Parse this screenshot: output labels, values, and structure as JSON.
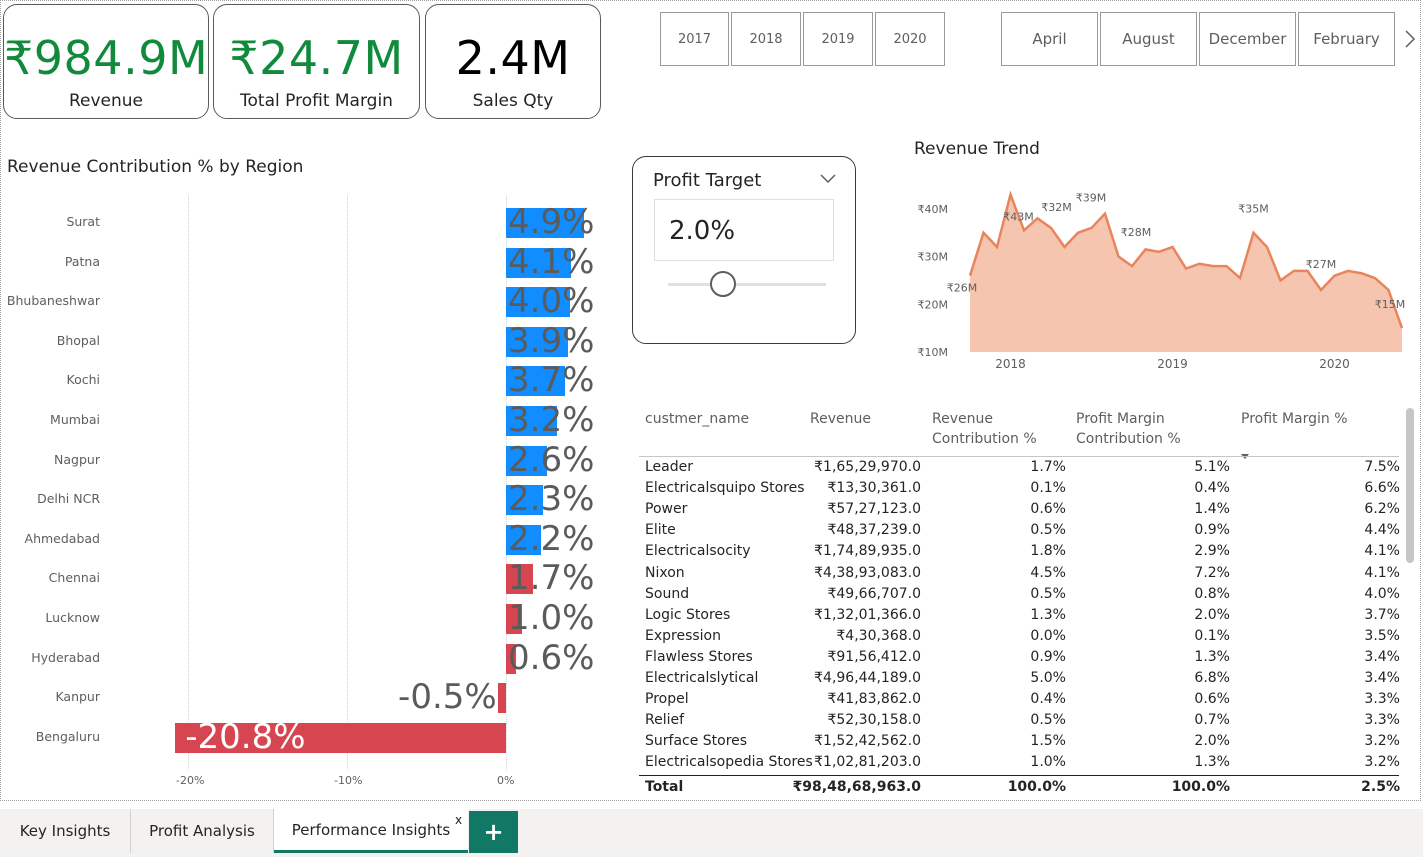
{
  "kpis": [
    {
      "value": "₹984.9M",
      "label": "Revenue",
      "color": "#118a3c"
    },
    {
      "value": "₹24.7M",
      "label": "Total Profit Margin",
      "color": "#118a3c"
    },
    {
      "value": "2.4M",
      "label": "Sales Qty",
      "color": "#000000"
    }
  ],
  "year_slicer": [
    "2017",
    "2018",
    "2019",
    "2020"
  ],
  "month_slicer": [
    "April",
    "August",
    "December",
    "February"
  ],
  "month_next_icon": "chevron-right-icon",
  "region_chart": {
    "title": "Revenue Contribution % by Region",
    "xticks": [
      "-20%",
      "-10%",
      "0%"
    ]
  },
  "profit_target": {
    "title": "Profit Target",
    "value": "2.0%",
    "slider_level": 0.0
  },
  "revenue_trend": {
    "title": "Revenue Trend"
  },
  "table": {
    "headers": [
      "custmer_name",
      "Revenue",
      "Revenue Contribution %",
      "Profit Margin Contribution %",
      "Profit Margin %"
    ],
    "rows": [
      [
        "Leader",
        "₹1,65,29,970.0",
        "1.7%",
        "5.1%",
        "7.5%"
      ],
      [
        "Electricalsquipo Stores",
        "₹13,30,361.0",
        "0.1%",
        "0.4%",
        "6.6%"
      ],
      [
        "Power",
        "₹57,27,123.0",
        "0.6%",
        "1.4%",
        "6.2%"
      ],
      [
        "Elite",
        "₹48,37,239.0",
        "0.5%",
        "0.9%",
        "4.4%"
      ],
      [
        "Electricalsocity",
        "₹1,74,89,935.0",
        "1.8%",
        "2.9%",
        "4.1%"
      ],
      [
        "Nixon",
        "₹4,38,93,083.0",
        "4.5%",
        "7.2%",
        "4.1%"
      ],
      [
        "Sound",
        "₹49,66,707.0",
        "0.5%",
        "0.8%",
        "4.0%"
      ],
      [
        "Logic Stores",
        "₹1,32,01,366.0",
        "1.3%",
        "2.0%",
        "3.7%"
      ],
      [
        "Expression",
        "₹4,30,368.0",
        "0.0%",
        "0.1%",
        "3.5%"
      ],
      [
        "Flawless Stores",
        "₹91,56,412.0",
        "0.9%",
        "1.3%",
        "3.4%"
      ],
      [
        "Electricalslytical",
        "₹4,96,44,189.0",
        "5.0%",
        "6.8%",
        "3.4%"
      ],
      [
        "Propel",
        "₹41,83,862.0",
        "0.4%",
        "0.6%",
        "3.3%"
      ],
      [
        "Relief",
        "₹52,30,158.0",
        "0.5%",
        "0.7%",
        "3.3%"
      ],
      [
        "Surface Stores",
        "₹1,52,42,562.0",
        "1.5%",
        "2.0%",
        "3.2%"
      ],
      [
        "Electricalsopedia Stores",
        "₹1,02,81,203.0",
        "1.0%",
        "1.3%",
        "3.2%"
      ]
    ],
    "total": [
      "Total",
      "₹98,48,68,963.0",
      "100.0%",
      "100.0%",
      "2.5%"
    ]
  },
  "tabs": [
    "Key Insights",
    "Profit Analysis",
    "Performance Insights"
  ],
  "active_tab": "Performance Insights",
  "tab_close": "x",
  "add_tab": "+",
  "chart_data": [
    {
      "type": "bar",
      "title": "Revenue Contribution % by Region",
      "categories": [
        "Surat",
        "Patna",
        "Bhubaneshwar",
        "Bhopal",
        "Kochi",
        "Mumbai",
        "Nagpur",
        "Delhi NCR",
        "Ahmedabad",
        "Chennai",
        "Lucknow",
        "Hyderabad",
        "Kanpur",
        "Bengaluru"
      ],
      "values": [
        4.9,
        4.1,
        4.0,
        3.9,
        3.7,
        3.2,
        2.6,
        2.3,
        2.2,
        1.7,
        1.0,
        0.6,
        -0.5,
        -20.8
      ],
      "labels": [
        "4.9%",
        "4.1%",
        "4.0%",
        "3.9%",
        "3.7%",
        "3.2%",
        "2.6%",
        "2.3%",
        "2.2%",
        "1.7%",
        "1.0%",
        "0.6%",
        "-0.5%",
        "-20.8%"
      ],
      "orientation": "horizontal",
      "xlim": [
        -21,
        5
      ],
      "grid": true,
      "colors": {
        "above_target": "#118dff",
        "below_target": "#d64550"
      }
    },
    {
      "type": "area",
      "title": "Revenue Trend",
      "x": [
        "2017-10",
        "2017-11",
        "2017-12",
        "2018-01",
        "2018-02",
        "2018-03",
        "2018-04",
        "2018-05",
        "2018-06",
        "2018-07",
        "2018-08",
        "2018-09",
        "2018-10",
        "2018-11",
        "2018-12",
        "2019-01",
        "2019-02",
        "2019-03",
        "2019-04",
        "2019-05",
        "2019-06",
        "2019-07",
        "2019-08",
        "2019-09",
        "2019-10",
        "2019-11",
        "2019-12",
        "2020-01",
        "2020-02",
        "2020-03",
        "2020-04",
        "2020-05",
        "2020-06"
      ],
      "y": [
        26,
        35,
        32,
        43,
        35.5,
        38,
        36,
        32,
        35,
        36,
        39,
        30,
        28,
        31.5,
        31,
        32,
        27.5,
        28.5,
        28,
        28,
        25.5,
        35,
        32,
        25,
        27,
        27,
        23,
        26,
        27,
        26.5,
        25.5,
        23,
        15
      ],
      "point_labels": [
        "₹26M",
        "₹43M",
        "₹32M",
        "₹39M",
        "₹28M",
        "₹35M",
        "₹27M",
        "₹15M"
      ],
      "xticks": [
        "2018",
        "2019",
        "2020"
      ],
      "yticks": [
        "₹10M",
        "₹20M",
        "₹30M",
        "₹40M"
      ],
      "ylim": [
        10,
        45
      ],
      "colors": {
        "line": "#e8855c",
        "fill": "#f5c5b0"
      }
    }
  ]
}
